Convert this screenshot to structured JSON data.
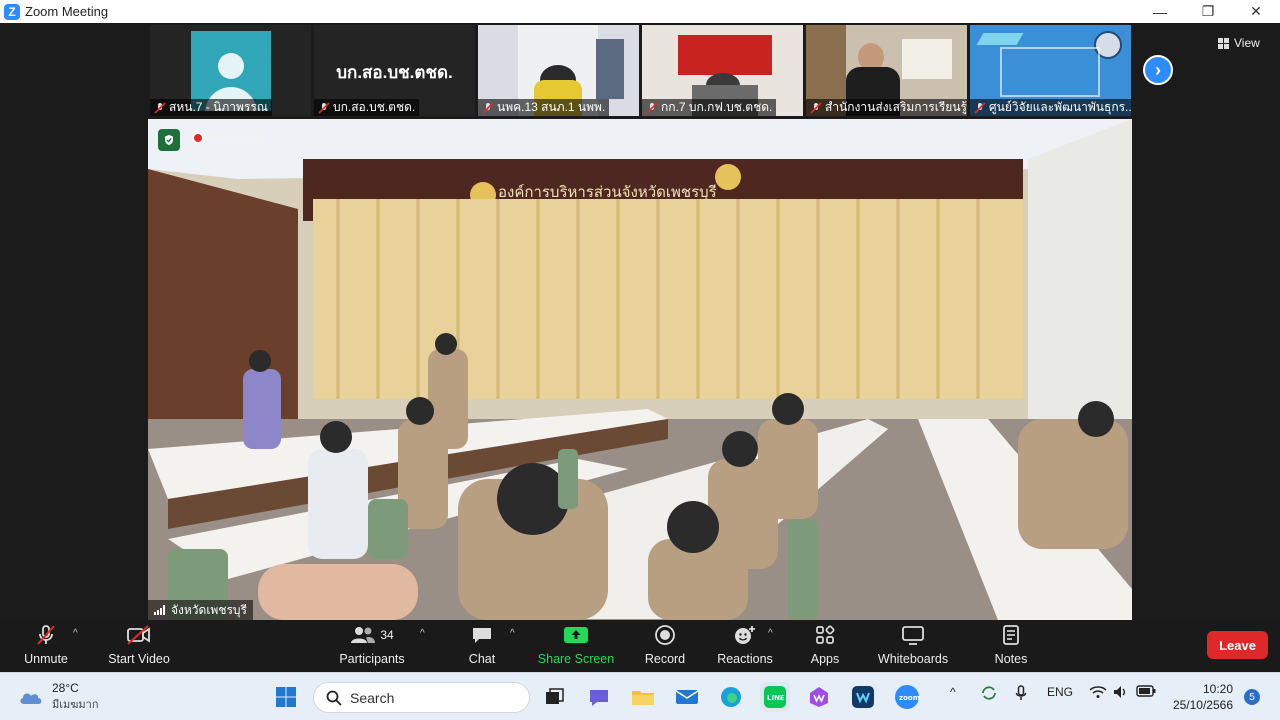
{
  "window": {
    "title": "Zoom Meeting"
  },
  "participants_strip": [
    {
      "name": "สหน.7 - นิภาพรรณ",
      "kind": "avatar"
    },
    {
      "name": "บก.สอ.บช.ตชด.",
      "kind": "text",
      "display_text": "บก.สอ.บช.ตชด."
    },
    {
      "name": "นพค.13 สนภ.1 นพพ.",
      "kind": "video"
    },
    {
      "name": "กก.7 บก.กฟ.บช.ตชด.",
      "kind": "video"
    },
    {
      "name": "สำนักงานส่งเสริมการเรียนรู้...",
      "kind": "video"
    },
    {
      "name": "ศูนย์วิจัยและพัฒนาพันธุกร...",
      "kind": "video"
    }
  ],
  "view_label": "View",
  "main_video": {
    "speaker_label": "จังหวัดเพชรบุรี",
    "recording_label": "Recording",
    "banner_text": "องค์การบริหารส่วนจังหวัดเพชรบุรี"
  },
  "toolbar": {
    "unmute": "Unmute",
    "start_video": "Start Video",
    "participants": "Participants",
    "participants_count": "34",
    "chat": "Chat",
    "share_screen": "Share Screen",
    "record": "Record",
    "reactions": "Reactions",
    "apps": "Apps",
    "whiteboards": "Whiteboards",
    "notes": "Notes",
    "leave": "Leave"
  },
  "taskbar": {
    "weather_temp": "28°C",
    "weather_desc": "มีเมฆมาก",
    "search_placeholder": "Search",
    "lang": "ENG",
    "time": "10:20",
    "date": "25/10/2566",
    "notification_count": "5"
  },
  "colors": {
    "accent": "#2d8cff",
    "share_green": "#23d959",
    "leave_red": "#e02828"
  }
}
